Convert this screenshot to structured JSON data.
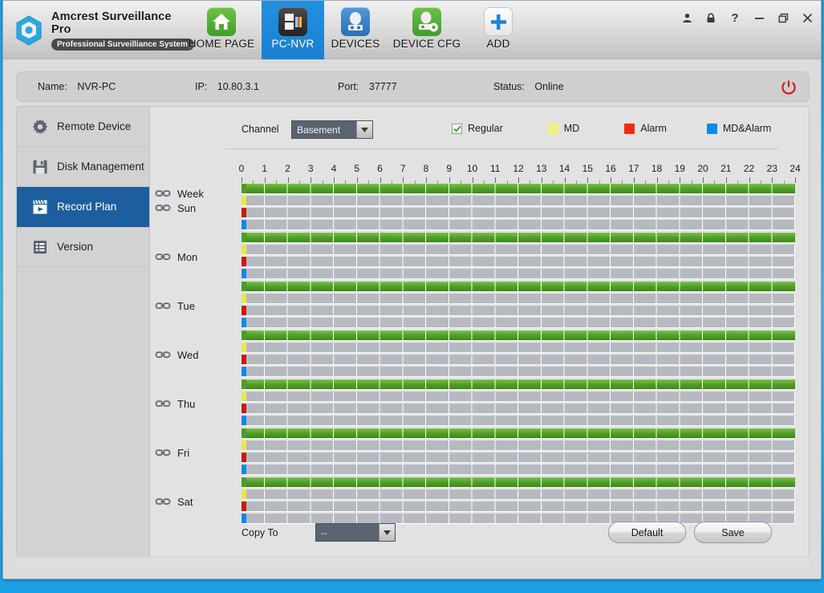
{
  "app": {
    "brand_title": "Amcrest Surveillance Pro",
    "brand_subtitle": "Professional Surveilliance System",
    "logo_icon": "hexagon-camera-logo"
  },
  "tabs": [
    {
      "label": "HOME PAGE",
      "icon": "home-icon",
      "active": false
    },
    {
      "label": "PC-NVR",
      "icon": "nvr-server-icon",
      "active": true
    },
    {
      "label": "DEVICES",
      "icon": "camera-icon",
      "active": false
    },
    {
      "label": "DEVICE CFG",
      "icon": "camera-gear-icon",
      "active": false
    },
    {
      "label": "ADD",
      "icon": "plus-icon",
      "active": false
    }
  ],
  "window_controls": [
    {
      "name": "user-account-icon",
      "glyph": "♟"
    },
    {
      "name": "lock-icon",
      "glyph": "ὑ2"
    },
    {
      "name": "help-icon",
      "glyph": "?"
    },
    {
      "name": "minimize-icon",
      "glyph": "−"
    },
    {
      "name": "restore-icon",
      "glyph": "❐"
    },
    {
      "name": "close-icon",
      "glyph": "✕"
    }
  ],
  "infobar": {
    "name_label": "Name:",
    "name_value": "NVR-PC",
    "ip_label": "IP:",
    "ip_value": "10.80.3.1",
    "port_label": "Port:",
    "port_value": "37777",
    "status_label": "Status:",
    "status_value": "Online",
    "power_icon": "power-icon"
  },
  "sidebar": {
    "items": [
      {
        "label": "Remote Device",
        "icon": "gear-icon",
        "active": false
      },
      {
        "label": "Disk Management",
        "icon": "floppy-disk-icon",
        "active": false
      },
      {
        "label": "Record Plan",
        "icon": "film-clapper-icon",
        "active": true
      },
      {
        "label": "Version",
        "icon": "list-document-icon",
        "active": false
      }
    ]
  },
  "controls": {
    "channel_label": "Channel",
    "channel_value": "Basement",
    "channel_arrow_icon": "chevron-down-icon",
    "copy_to_label": "Copy To",
    "copy_to_value": "--",
    "copy_to_arrow_icon": "chevron-down-icon",
    "default_button": "Default",
    "save_button": "Save"
  },
  "legend": [
    {
      "label": "Regular",
      "color": "#3e8a1c",
      "type": "checkbox",
      "checked": true
    },
    {
      "label": "MD",
      "color": "#f4f477",
      "type": "swatch",
      "checked": false
    },
    {
      "label": "Alarm",
      "color": "#f42a0c",
      "type": "swatch",
      "checked": false
    },
    {
      "label": "MD&Alarm",
      "color": "#0d8ae8",
      "type": "swatch",
      "checked": false
    }
  ],
  "schedule": {
    "week_label": "Week",
    "link_icon": "chain-link-icon",
    "row_gear_icon": "gear-icon",
    "axis_ticks": [
      "0",
      "1",
      "2",
      "3",
      "4",
      "5",
      "6",
      "7",
      "8",
      "9",
      "10",
      "11",
      "12",
      "13",
      "14",
      "15",
      "16",
      "17",
      "18",
      "19",
      "20",
      "21",
      "22",
      "23",
      "24"
    ],
    "axis_min": 0,
    "axis_max": 24,
    "track_colors": {
      "regular": "#3e8a1c",
      "md": "#e8e84a",
      "alarm": "#c91a0a",
      "md_alarm": "#0d8ae8",
      "empty": "#b6bac0"
    },
    "days": [
      {
        "label": "Sun",
        "tracks": [
          {
            "type": "Regular",
            "swatch": "#4e9c25",
            "filled": true,
            "ranges": [
              [
                0,
                24
              ]
            ]
          },
          {
            "type": "MD",
            "swatch": "#e8e84a",
            "filled": false,
            "ranges": []
          },
          {
            "type": "Alarm",
            "swatch": "#c91a0a",
            "filled": false,
            "ranges": []
          },
          {
            "type": "MD&Alarm",
            "swatch": "#0d8ae8",
            "filled": false,
            "ranges": []
          }
        ]
      },
      {
        "label": "Mon",
        "tracks": [
          {
            "type": "Regular",
            "swatch": "#4e9c25",
            "filled": true,
            "ranges": [
              [
                0,
                24
              ]
            ]
          },
          {
            "type": "MD",
            "swatch": "#e8e84a",
            "filled": false,
            "ranges": []
          },
          {
            "type": "Alarm",
            "swatch": "#c91a0a",
            "filled": false,
            "ranges": []
          },
          {
            "type": "MD&Alarm",
            "swatch": "#0d8ae8",
            "filled": false,
            "ranges": []
          }
        ]
      },
      {
        "label": "Tue",
        "tracks": [
          {
            "type": "Regular",
            "swatch": "#4e9c25",
            "filled": true,
            "ranges": [
              [
                0,
                24
              ]
            ]
          },
          {
            "type": "MD",
            "swatch": "#e8e84a",
            "filled": false,
            "ranges": []
          },
          {
            "type": "Alarm",
            "swatch": "#c91a0a",
            "filled": false,
            "ranges": []
          },
          {
            "type": "MD&Alarm",
            "swatch": "#0d8ae8",
            "filled": false,
            "ranges": []
          }
        ]
      },
      {
        "label": "Wed",
        "tracks": [
          {
            "type": "Regular",
            "swatch": "#4e9c25",
            "filled": true,
            "ranges": [
              [
                0,
                24
              ]
            ]
          },
          {
            "type": "MD",
            "swatch": "#e8e84a",
            "filled": false,
            "ranges": []
          },
          {
            "type": "Alarm",
            "swatch": "#c91a0a",
            "filled": false,
            "ranges": []
          },
          {
            "type": "MD&Alarm",
            "swatch": "#0d8ae8",
            "filled": false,
            "ranges": []
          }
        ]
      },
      {
        "label": "Thu",
        "tracks": [
          {
            "type": "Regular",
            "swatch": "#4e9c25",
            "filled": true,
            "ranges": [
              [
                0,
                24
              ]
            ]
          },
          {
            "type": "MD",
            "swatch": "#e8e84a",
            "filled": false,
            "ranges": []
          },
          {
            "type": "Alarm",
            "swatch": "#c91a0a",
            "filled": false,
            "ranges": []
          },
          {
            "type": "MD&Alarm",
            "swatch": "#0d8ae8",
            "filled": false,
            "ranges": []
          }
        ]
      },
      {
        "label": "Fri",
        "tracks": [
          {
            "type": "Regular",
            "swatch": "#4e9c25",
            "filled": true,
            "ranges": [
              [
                0,
                24
              ]
            ]
          },
          {
            "type": "MD",
            "swatch": "#e8e84a",
            "filled": false,
            "ranges": []
          },
          {
            "type": "Alarm",
            "swatch": "#c91a0a",
            "filled": false,
            "ranges": []
          },
          {
            "type": "MD&Alarm",
            "swatch": "#0d8ae8",
            "filled": false,
            "ranges": []
          }
        ]
      },
      {
        "label": "Sat",
        "tracks": [
          {
            "type": "Regular",
            "swatch": "#4e9c25",
            "filled": true,
            "ranges": [
              [
                0,
                24
              ]
            ]
          },
          {
            "type": "MD",
            "swatch": "#e8e84a",
            "filled": false,
            "ranges": []
          },
          {
            "type": "Alarm",
            "swatch": "#c91a0a",
            "filled": false,
            "ranges": []
          },
          {
            "type": "MD&Alarm",
            "swatch": "#0d8ae8",
            "filled": false,
            "ranges": []
          }
        ]
      }
    ]
  }
}
